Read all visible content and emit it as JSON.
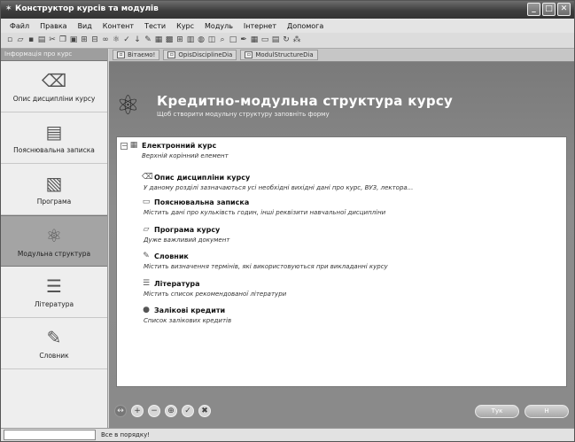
{
  "window": {
    "title": "Конструктор курсів та модулів",
    "buttons": [
      "_",
      "□",
      "✕"
    ]
  },
  "menu": [
    "Файл",
    "Правка",
    "Вид",
    "Контент",
    "Тести",
    "Курс",
    "Модуль",
    "Інтернет",
    "Допомога"
  ],
  "sidebar": {
    "header": "Інформація про курс",
    "items": [
      {
        "label": "Опис дисципліни курсу",
        "icon": "eraser-icon",
        "glyph": "⌫",
        "selected": false
      },
      {
        "label": "Пояснювальна записка",
        "icon": "page-icon",
        "glyph": "▤",
        "selected": false
      },
      {
        "label": "Програма",
        "icon": "document-icon",
        "glyph": "▧",
        "selected": false
      },
      {
        "label": "Модульна структура",
        "icon": "molecule-icon",
        "glyph": "⚛",
        "selected": true
      },
      {
        "label": "Література",
        "icon": "books-icon",
        "glyph": "☰",
        "selected": false
      },
      {
        "label": "Словник",
        "icon": "notepad-icon",
        "glyph": "✎",
        "selected": false
      }
    ]
  },
  "tabs": [
    {
      "label": "Вітаємо!"
    },
    {
      "label": "OpisDisciplineDia"
    },
    {
      "label": "ModulStructureDia"
    }
  ],
  "header": {
    "title": "Кредитно-модульна структура курсу",
    "subtitle": "Щоб створити модульну структуру заповніть форму"
  },
  "tree": {
    "root": {
      "title": "Електронний курс",
      "desc": "Верхній корінний елемент"
    },
    "items": [
      {
        "title": "Опис дисципліни курсу",
        "desc": "У даному розділі зазначаються усі необхідні вихідні дані про курс, ВУЗ, лектора...",
        "icon": "eraser-icon",
        "glyph": "⌫"
      },
      {
        "title": "Пояснювальна записка",
        "desc": "Містить дані про кульківсть годин, інші реквізити навчальної дисципліни",
        "icon": "page-icon",
        "glyph": "▭"
      },
      {
        "title": "Програма курсу",
        "desc": "Дуже важливий документ",
        "icon": "folder-icon",
        "glyph": "▱"
      },
      {
        "title": "Словник",
        "desc": "Містить визначення термінів, які використовуються при викладанні курсу",
        "icon": "notepad-icon",
        "glyph": "✎"
      },
      {
        "title": "Література",
        "desc": "Містить список рекомендованої літератури",
        "icon": "books-icon",
        "glyph": "☰"
      },
      {
        "title": "Залікові кредити",
        "desc": "Список залікових кредитів",
        "icon": "ball-icon",
        "glyph": "●"
      }
    ]
  },
  "bottom": {
    "tools": [
      "↔",
      "+",
      "−",
      "⊕",
      "✓",
      "✖"
    ],
    "back_label": "Тук",
    "next_label": "Н"
  },
  "status": {
    "text": "Все в порядку!"
  }
}
